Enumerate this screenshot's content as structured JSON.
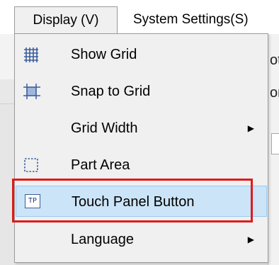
{
  "menubar": {
    "display": "Display (V)",
    "system_settings": "System Settings(S)"
  },
  "background": {
    "peek_text": "ot",
    "peek_text_2": "or"
  },
  "dropdown": {
    "items": [
      {
        "label": "Show Grid",
        "icon": "grid-icon"
      },
      {
        "label": "Snap to Grid",
        "icon": "snap-grid-icon"
      },
      {
        "label": "Grid Width",
        "icon": "",
        "submenu": true
      },
      {
        "label": "Part Area",
        "icon": "part-area-icon"
      },
      {
        "label": "Touch Panel Button",
        "icon": "touch-panel-icon",
        "icon_text": "TP",
        "highlighted": true
      },
      {
        "label": "Language",
        "icon": "",
        "submenu": true
      }
    ],
    "submenu_arrow": "▶"
  },
  "colors": {
    "highlight": "#cce4f7",
    "annotation_red": "#e01a1a",
    "icon_blue": "#3b5e9c"
  }
}
